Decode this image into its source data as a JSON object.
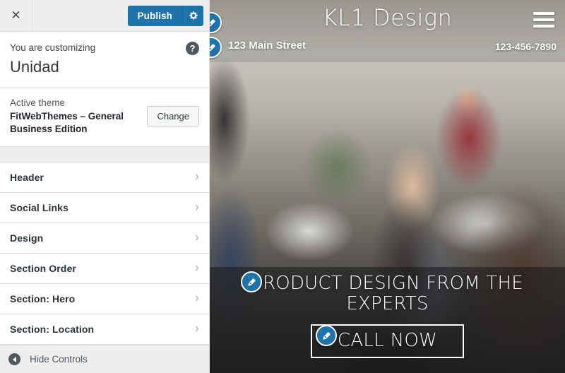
{
  "customizer": {
    "close_icon": "close-x-icon",
    "publish_label": "Publish",
    "gear_icon": "gear-icon",
    "customizing_label": "You are customizing",
    "site_name": "Unidad",
    "help_icon": "help-question-icon",
    "theme": {
      "active_label": "Active theme",
      "name": "FitWebThemes – General Business Edition",
      "change_label": "Change"
    },
    "panels": [
      {
        "label": "Header",
        "chevron": "chevron-right-icon"
      },
      {
        "label": "Social Links",
        "chevron": "chevron-right-icon"
      },
      {
        "label": "Design",
        "chevron": "chevron-right-icon"
      },
      {
        "label": "Section Order",
        "chevron": "chevron-right-icon"
      },
      {
        "label": "Section: Hero",
        "chevron": "chevron-right-icon"
      },
      {
        "label": "Section: Location",
        "chevron": "chevron-right-icon"
      }
    ],
    "hide_controls_label": "Hide Controls",
    "collapse_icon": "collapse-left-arrow-icon",
    "accent_color": "#1e73aa"
  },
  "preview": {
    "site_title": "KL1 Design",
    "address": "123 Main Street",
    "phone": "123-456-7890",
    "menu_icon": "hamburger-menu-icon",
    "hero": {
      "title": "PRODUCT DESIGN FROM THE EXPERTS",
      "cta_label": "CALL NOW"
    },
    "edit_shortcuts": [
      {
        "name": "edit-site-title",
        "icon": "pencil-icon"
      },
      {
        "name": "edit-address",
        "icon": "pencil-icon"
      },
      {
        "name": "edit-hero-title",
        "icon": "pencil-icon"
      },
      {
        "name": "edit-hero-cta",
        "icon": "pencil-icon"
      }
    ]
  }
}
